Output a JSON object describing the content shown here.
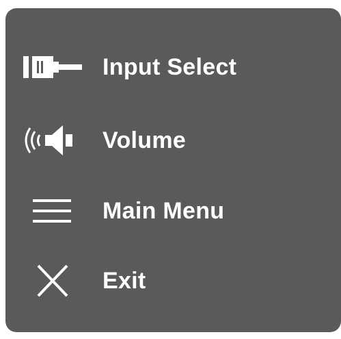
{
  "osd_menu": {
    "items": [
      {
        "label": "Input Select",
        "icon": "input-connector-icon"
      },
      {
        "label": "Volume",
        "icon": "speaker-volume-icon"
      },
      {
        "label": "Main Menu",
        "icon": "hamburger-menu-icon"
      },
      {
        "label": "Exit",
        "icon": "close-x-icon"
      }
    ]
  },
  "colors": {
    "panel_background": "#5a5a5a",
    "text": "#ffffff",
    "icon": "#ffffff",
    "page_background": "#ffffff"
  }
}
